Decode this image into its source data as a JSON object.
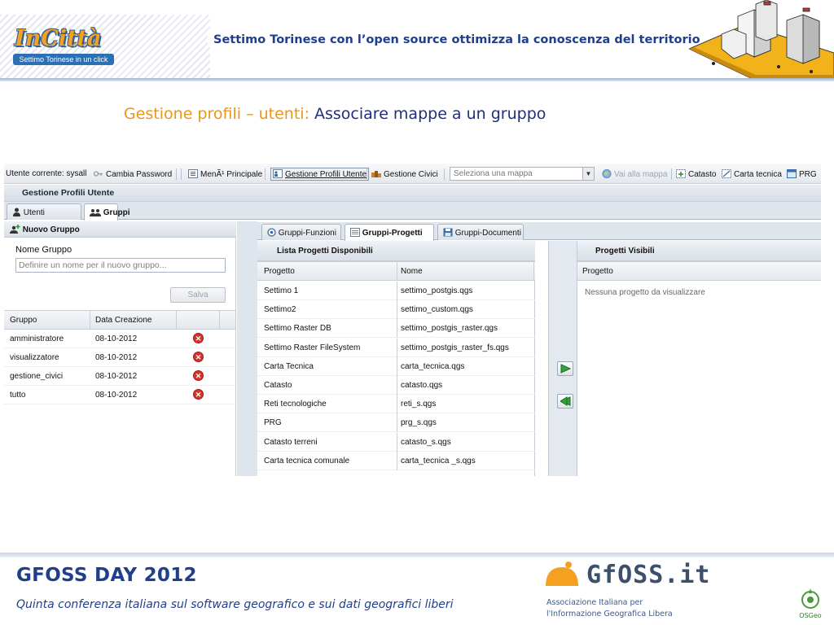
{
  "header": {
    "logo_text": "InCittà",
    "logo_sub": "Settimo Torinese in un click",
    "title": "Settimo Torinese con l’open source ottimizza la conoscenza del territorio"
  },
  "subtitle": {
    "part1": "Gestione profili – utenti: ",
    "part2": "Associare mappe a un gruppo"
  },
  "app": {
    "toolbar": {
      "current_user": "Utente corrente: sysall",
      "change_password": "Cambia Password",
      "main_menu": "MenÃ¹ Principale",
      "profile_mgmt": "Gestione Profili Utente",
      "civic_mgmt": "Gestione Civici",
      "map_select_placeholder": "Seleziona una mappa",
      "goto_map": "Vai alla mappa",
      "catasto": "Catasto",
      "carta_tecnica": "Carta tecnica",
      "prg": "PRG"
    },
    "panel_title": "Gestione Profili Utente",
    "tabs": [
      "Utenti",
      "Gruppi"
    ],
    "left": {
      "new_group_title": "Nuovo Gruppo",
      "name_label": "Nome Gruppo",
      "name_placeholder": "Definire un nome per il nuovo gruppo...",
      "save_button": "Salva",
      "columns": [
        "Gruppo",
        "Data Creazione"
      ],
      "rows": [
        {
          "name": "amministratore",
          "date": "08-10-2012"
        },
        {
          "name": "visualizzatore",
          "date": "08-10-2012"
        },
        {
          "name": "gestione_civici",
          "date": "08-10-2012"
        },
        {
          "name": "tutto",
          "date": "08-10-2012"
        }
      ]
    },
    "right": {
      "tabs": [
        "Gruppi-Funzioni",
        "Gruppi-Progetti",
        "Gruppi-Documenti"
      ],
      "available_title": "Lista Progetti Disponibili",
      "available_columns": [
        "Progetto",
        "Nome"
      ],
      "projects": [
        {
          "project": "Settimo 1",
          "file": "settimo_postgis.qgs"
        },
        {
          "project": "Settimo2",
          "file": "settimo_custom.qgs"
        },
        {
          "project": "Settimo Raster DB",
          "file": "settimo_postgis_raster.qgs"
        },
        {
          "project": "Settimo Raster FileSystem",
          "file": "settimo_postgis_raster_fs.qgs"
        },
        {
          "project": "Carta Tecnica",
          "file": "carta_tecnica.qgs"
        },
        {
          "project": "Catasto",
          "file": "catasto.qgs"
        },
        {
          "project": "Reti tecnologiche",
          "file": "reti_s.qgs"
        },
        {
          "project": "PRG",
          "file": "prg_s.qgs"
        },
        {
          "project": "Catasto terreni",
          "file": "catasto_s.qgs"
        },
        {
          "project": "Carta tecnica comunale",
          "file": "carta_tecnica _s.qgs"
        }
      ],
      "visible_title": "Progetti Visibili",
      "visible_column": "Progetto",
      "empty_text": "Nessuna progetto da visualizzare"
    }
  },
  "footer": {
    "title": "GFOSS DAY 2012",
    "subtitle": "Quinta conferenza italiana sul software geografico e sui dati geografici liberi",
    "gfoss_word": "GfOSS.it",
    "gfoss_desc_1": "Associazione Italiana per",
    "gfoss_desc_2": "l'Informazione Geografica Libera",
    "osgeo": "OSGeo"
  },
  "colors": {
    "title_blue": "#1f3e8c",
    "subtitle_orange": "#e8961e",
    "delete_red": "#d5332b"
  }
}
